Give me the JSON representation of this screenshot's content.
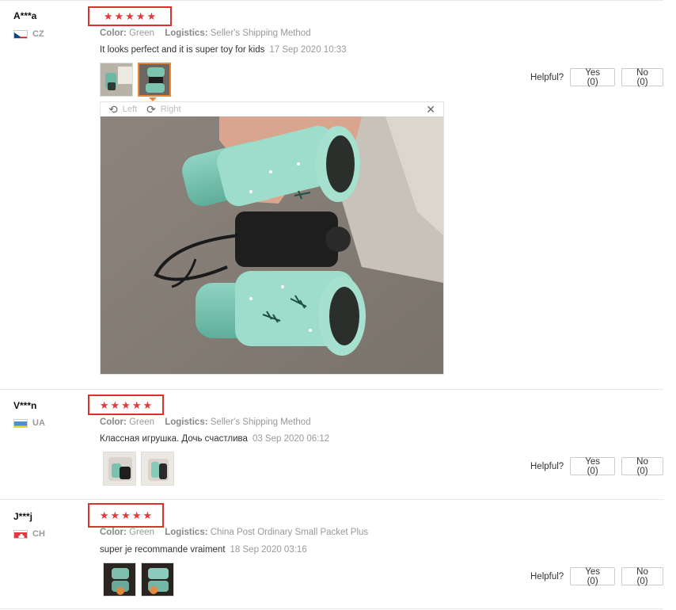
{
  "reviews": [
    {
      "user": "A***a",
      "country": "CZ",
      "rating_stars": 5,
      "color_label": "Color:",
      "color_value": "Green",
      "logistics_label": "Logistics:",
      "logistics_value": "Seller's Shipping Method",
      "text": "It looks perfect and it is super toy for kids",
      "date": "17 Sep 2020 10:33",
      "helpful_label": "Helpful?",
      "yes_label": "Yes (0)",
      "no_label": "No (0)"
    },
    {
      "user": "V***n",
      "country": "UA",
      "rating_stars": 5,
      "color_label": "Color:",
      "color_value": "Green",
      "logistics_label": "Logistics:",
      "logistics_value": "Seller's Shipping Method",
      "text": "Классная игрушка. Дочь счастлива",
      "date": "03 Sep 2020 06:12",
      "helpful_label": "Helpful?",
      "yes_label": "Yes (0)",
      "no_label": "No (0)"
    },
    {
      "user": "J***j",
      "country": "CH",
      "rating_stars": 5,
      "color_label": "Color:",
      "color_value": "Green",
      "logistics_label": "Logistics:",
      "logistics_value": "China Post Ordinary Small Packet Plus",
      "text": "super je recommande vraiment",
      "date": "18 Sep 2020 03:16",
      "helpful_label": "Helpful?",
      "yes_label": "Yes (0)",
      "no_label": "No (0)"
    }
  ],
  "viewer": {
    "rotate_left_label": "Left",
    "rotate_right_label": "Right",
    "close_icon": "close-icon"
  },
  "colors": {
    "star": "#e4393c",
    "highlight_box": "#d9332b",
    "active_thumb": "#e8873a"
  }
}
